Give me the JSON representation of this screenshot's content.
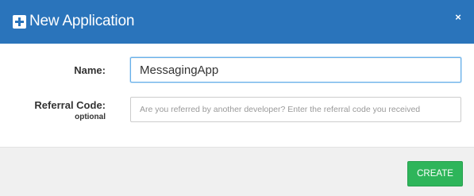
{
  "modal": {
    "title": "New Application",
    "close_symbol": "×",
    "icon": "plus-square-icon"
  },
  "form": {
    "name": {
      "label": "Name:",
      "value": "MessagingApp"
    },
    "referral": {
      "label": "Referral Code:",
      "sublabel": "optional",
      "placeholder": "Are you referred by another developer? Enter the referral code you received",
      "value": ""
    }
  },
  "footer": {
    "create_label": "CREATE"
  },
  "colors": {
    "header_bg": "#2a74bb",
    "create_button_bg": "#2eb55a",
    "footer_bg": "#f0f0f0",
    "focus_border": "#66afe9"
  }
}
